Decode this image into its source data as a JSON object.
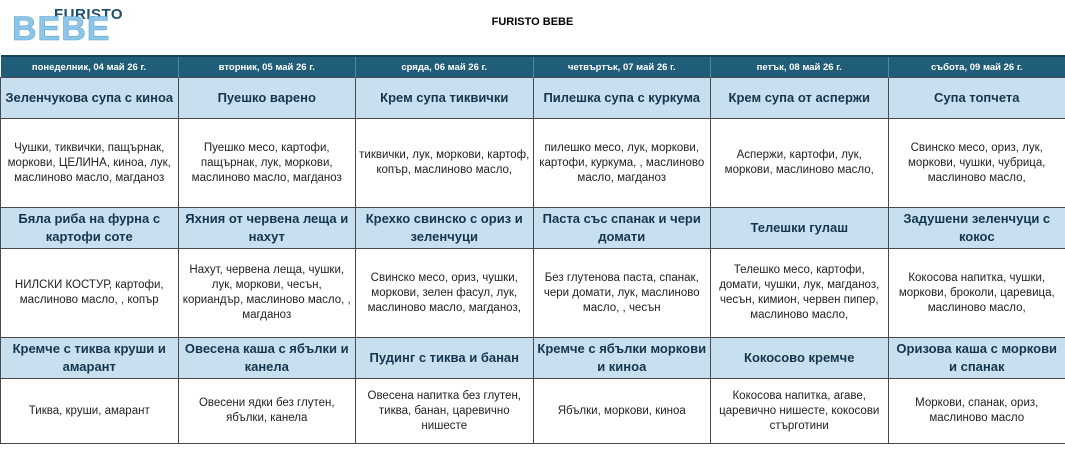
{
  "header": {
    "logo_top": "FURISTO",
    "logo_bottom": "BEBE",
    "title": "FURISTO BEBE"
  },
  "days": [
    "понеделник, 04 май 26 г.",
    "вторник, 05 май 26 г.",
    "сряда, 06 май 26 г.",
    "четвъртък, 07 май 26 г.",
    "петък, 08 май 26 г.",
    "събота, 09 май 26 г."
  ],
  "meals": [
    [
      {
        "dish": "Зеленчукова супа с киноа",
        "ingredients": "Чушки, тиквички, пащърнак, моркови, ЦЕЛИНА, киноа, лук, маслиново масло, магданоз"
      },
      {
        "dish": "Пуешко варено",
        "ingredients": "Пуешко месо, картофи, пащърнак, лук, моркови, маслиново масло, магданоз"
      },
      {
        "dish": "Крем супа тиквички",
        "ingredients": "тиквички, лук, моркови, картоф, копър, маслиново масло,"
      },
      {
        "dish": "Пилешка супа с куркума",
        "ingredients": "пилешко месо, лук, моркови, картофи, куркума, , маслиново масло, магданоз"
      },
      {
        "dish": "Крем супа от аспержи",
        "ingredients": "Аспержи, картофи, лук, моркови, маслиново масло,"
      },
      {
        "dish": "Супа топчета",
        "ingredients": "Свинско месо, ориз, лук, моркови, чушки, чубрица, маслиново масло,"
      }
    ],
    [
      {
        "dish": "Бяла риба на фурна с картофи соте",
        "ingredients": "НИЛСКИ КОСТУР, картофи, маслиново масло, , копър"
      },
      {
        "dish": "Яхния от червена леща и нахут",
        "ingredients": "Нахут, червена леща, чушки, лук, моркови, чесън, кориандър, маслиново масло, , магданоз"
      },
      {
        "dish": "Крехко свинско с ориз и зеленчуци",
        "ingredients": "Свинско месо, ориз, чушки, моркови, зелен фасул, лук, маслиново масло, магданоз,"
      },
      {
        "dish": "Паста със спанак и чери домати",
        "ingredients": "Без глутенова паста, спанак, чери домати, лук, маслиново масло, , чесън"
      },
      {
        "dish": "Телешки гулаш",
        "ingredients": "Телешко месо, картофи, домати, чушки, лук, магданоз, чесън, кимион, червен пипер, маслиново масло,"
      },
      {
        "dish": "Задушени зеленчуци с кокос",
        "ingredients": "Кокосова напитка, чушки, моркови, броколи, царевица, маслиново масло,"
      }
    ],
    [
      {
        "dish": "Кремче с тиква круши и амарант",
        "ingredients": "Тиква, круши, амарант"
      },
      {
        "dish": "Овесена каша с ябълки и канела",
        "ingredients": "Овесени ядки без глутен, ябълки, канела"
      },
      {
        "dish": "Пудинг с тиква и банан",
        "ingredients": "Овесена напитка без глутен, тиква, банан, царевично нишесте"
      },
      {
        "dish": "Кремче с ябълки моркови и киноа",
        "ingredients": "Ябълки, моркови, киноа"
      },
      {
        "dish": "Кокосово кремче",
        "ingredients": "Кокосова напитка, агаве, царевично нишесте, кокосови стърготини"
      },
      {
        "dish": "Оризова каша с моркови и спанак",
        "ingredients": "Моркови, спанак, ориз, маслиново масло"
      }
    ]
  ]
}
